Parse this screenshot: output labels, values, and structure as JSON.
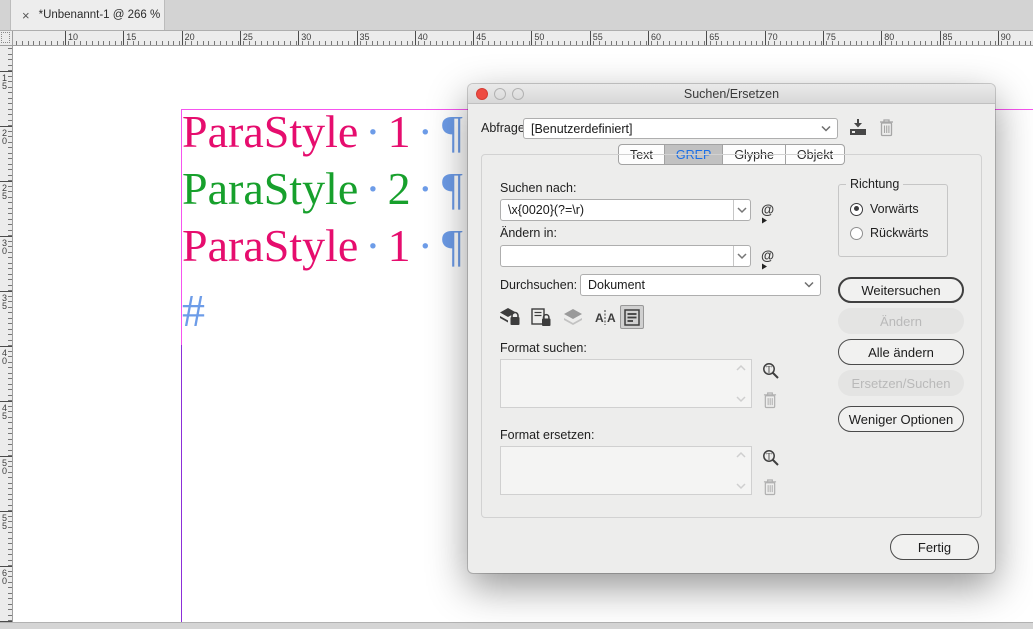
{
  "colors": {
    "para_pink": "#e60d6e",
    "para_green": "#17a02c",
    "hidden_chars": "#6d9ce8",
    "margin_guide": "#f653ef",
    "column_guide": "#8c2fd8",
    "accent_blue": "#1a6fe8",
    "traffic_red": "#ee4b42"
  },
  "window_tab": {
    "close": "×",
    "title": "*Unbenannt-1 @ 266 %"
  },
  "rulers": {
    "top_labels": [
      "10",
      "15",
      "20",
      "25",
      "30",
      "35",
      "40",
      "45",
      "50",
      "55",
      "60",
      "65",
      "70",
      "75",
      "80",
      "85",
      "90"
    ],
    "left_labels": [
      "15",
      "20",
      "25",
      "30",
      "35",
      "40",
      "45",
      "50",
      "55",
      "60"
    ]
  },
  "canvas": {
    "paragraphs": [
      {
        "text": "ParaStyle",
        "space_dot": "·",
        "number": "1",
        "space_dot2": "·",
        "pilcrow": "¶",
        "color": "para_pink"
      },
      {
        "text": "ParaStyle",
        "space_dot": "·",
        "number": "2",
        "space_dot2": "·",
        "pilcrow": "¶",
        "color": "para_green"
      },
      {
        "text": "ParaStyle",
        "space_dot": "·",
        "number": "1",
        "space_dot2": "·",
        "pilcrow": "¶",
        "color": "para_pink"
      }
    ],
    "end_of_story_marker": "#"
  },
  "dialog": {
    "title": "Suchen/Ersetzen",
    "query": {
      "label": "Abfrage:",
      "value": "[Benutzerdefiniert]"
    },
    "tabs": [
      {
        "label": "Text",
        "active": false
      },
      {
        "label": "GREP",
        "active": true
      },
      {
        "label": "Glyphe",
        "active": false
      },
      {
        "label": "Objekt",
        "active": false
      }
    ],
    "find": {
      "label": "Suchen nach:",
      "value": "\\x{0020}(?=\\r)",
      "at_symbol": "@"
    },
    "change": {
      "label": "Ändern in:",
      "value": "",
      "at_symbol": "@"
    },
    "scope": {
      "label": "Durchsuchen:",
      "value": "Dokument"
    },
    "toggles": [
      {
        "name": "locked-layers",
        "active": false
      },
      {
        "name": "locked-stories",
        "active": false
      },
      {
        "name": "hidden-layers",
        "active": false
      },
      {
        "name": "master-pages",
        "active": false
      },
      {
        "name": "footnotes",
        "active": true
      }
    ],
    "format_find": {
      "label": "Format suchen:"
    },
    "format_change": {
      "label": "Format ersetzen:"
    },
    "direction": {
      "legend": "Richtung",
      "options": [
        {
          "label": "Vorwärts",
          "selected": true
        },
        {
          "label": "Rückwärts",
          "selected": false
        }
      ]
    },
    "buttons": {
      "find_next": "Weitersuchen",
      "change": "Ändern",
      "change_all": "Alle ändern",
      "change_find": "Ersetzen/Suchen",
      "fewer_options": "Weniger Optionen",
      "done": "Fertig"
    }
  }
}
